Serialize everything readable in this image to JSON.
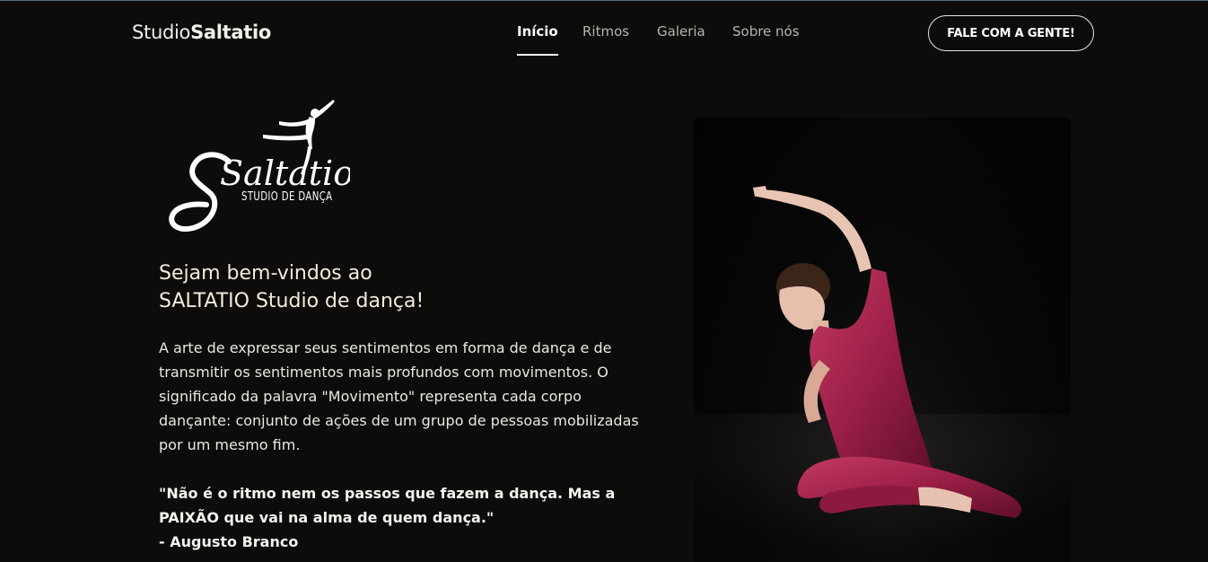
{
  "header": {
    "brand_light": "Studio",
    "brand_bold": "Saltatio",
    "nav": [
      {
        "label": "Início",
        "active": true
      },
      {
        "label": "Ritmos",
        "active": false
      },
      {
        "label": "Galeria",
        "active": false
      },
      {
        "label": "Sobre nós",
        "active": false
      }
    ],
    "cta_label": "FALE COM A GENTE!"
  },
  "logo": {
    "title": "Saltatio",
    "subtitle": "STUDIO DE DANÇA"
  },
  "hero": {
    "welcome_line1": "Sejam bem-vindos ao",
    "welcome_line2": "SALTATIO Studio de dança!",
    "paragraph": "A arte de expressar seus sentimentos em forma de dança e de transmitir os sentimentos mais profundos com movimentos. O significado da palavra \"Movimento\" representa cada corpo dançante: conjunto de ações de um grupo de pessoas mobilizadas por um mesmo fim.",
    "quote_line1": "\"Não é o ritmo nem os passos que fazem a dança. Mas a",
    "quote_line2": "PAIXÃO que vai na alma de quem dança.\"",
    "quote_author": "- Augusto Branco"
  },
  "colors": {
    "background": "#0d0c0b",
    "text": "#f2efe9",
    "accent_costume": "#9c1f47"
  }
}
